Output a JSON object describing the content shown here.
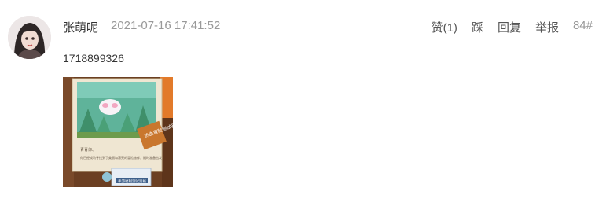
{
  "comment": {
    "username": "张萌呢",
    "timestamp": "2021-07-16 17:41:52",
    "text": "1718899326",
    "actions": {
      "like": "赞(1)",
      "dislike": "踩",
      "reply": "回复",
      "report": "举报"
    },
    "floor": "84#",
    "image": {
      "ribbon_text": "热血冒险测试开始",
      "dialog_name": "青青你、",
      "dialog_body": "你已经成功寻找到了美丽和漂亮的冒险旅伴，随时准备出发！",
      "button_text": "手游福利测试资格"
    }
  }
}
